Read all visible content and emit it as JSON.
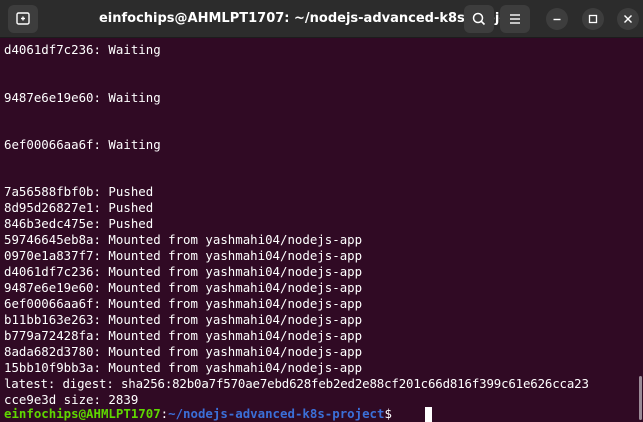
{
  "window": {
    "title": "einfochips@AHMLPT1707: ~/nodejs-advanced-k8s-project"
  },
  "titlebar_buttons": {
    "new_tab": "new-tab-icon",
    "search": "search-icon",
    "menu": "hamburger-menu-icon",
    "minimize": "minimize-icon",
    "maximize": "maximize-icon",
    "close": "close-icon"
  },
  "terminal": {
    "colors": {
      "background": "#300a24",
      "text": "#ffffff",
      "prompt_user": "#5fd700",
      "prompt_path": "#3b6fd8"
    },
    "lines": [
      "d4061df7c236: Waiting",
      "9487e6e19e60: Waiting",
      "6ef00066aa6f: Waiting",
      "7a56588fbf0b: Pushed",
      "8d95d26827e1: Pushed",
      "846b3edc475e: Pushed",
      "59746645eb8a: Mounted from yashmahi04/nodejs-app",
      "0970e1a837f7: Mounted from yashmahi04/nodejs-app",
      "d4061df7c236: Mounted from yashmahi04/nodejs-app",
      "9487e6e19e60: Mounted from yashmahi04/nodejs-app",
      "6ef00066aa6f: Mounted from yashmahi04/nodejs-app",
      "b11bb163e263: Mounted from yashmahi04/nodejs-app",
      "b779a72428fa: Mounted from yashmahi04/nodejs-app",
      "8ada682d3780: Mounted from yashmahi04/nodejs-app",
      "15bb10f9bb3a: Mounted from yashmahi04/nodejs-app",
      "latest: digest: sha256:82b0a7f570ae7ebd628feb2ed2e88cf201c66d816f399c61e626cca23",
      "cce9e3d size: 2839"
    ],
    "prompt": {
      "user_host": "einfochips@AHMLPT1707",
      "separator": ":",
      "path": "~/nodejs-advanced-k8s-project",
      "symbol": "$"
    }
  }
}
